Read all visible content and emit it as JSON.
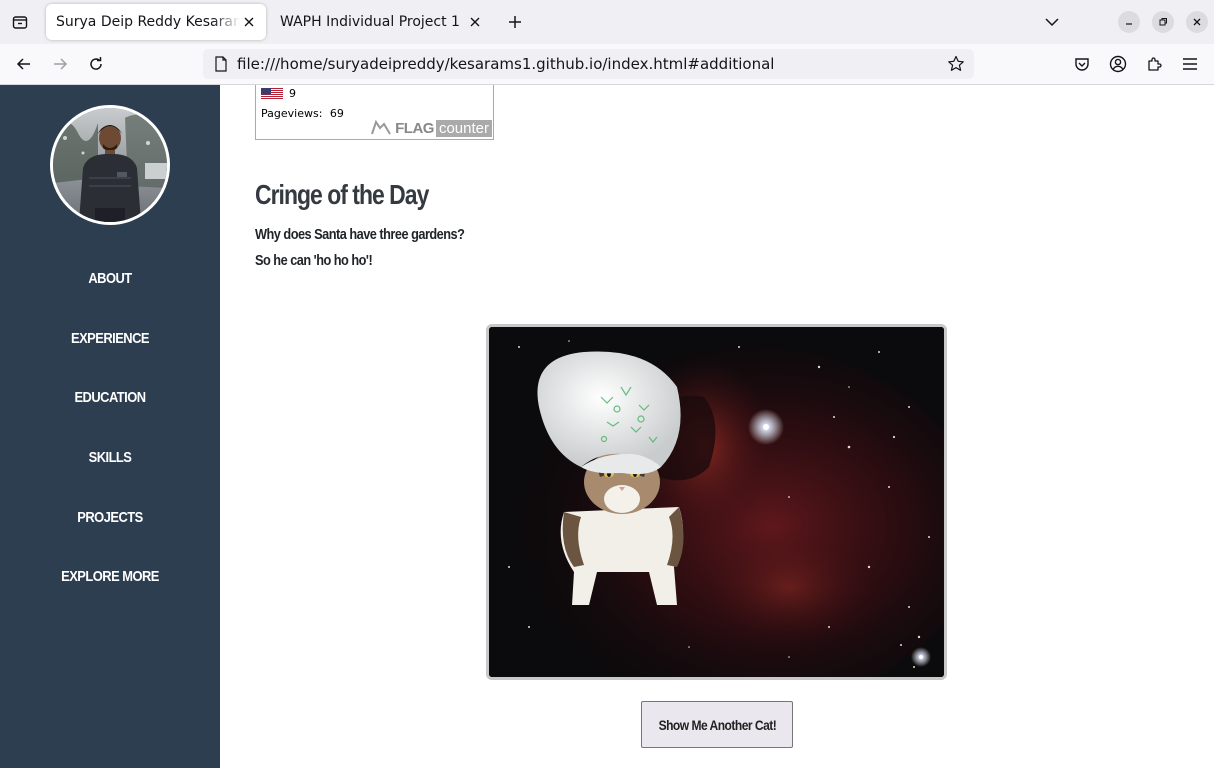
{
  "browser": {
    "tabs": [
      {
        "title": "Surya Deip Reddy Kesaram - I",
        "active": true
      },
      {
        "title": "WAPH Individual Project 1",
        "active": false
      }
    ],
    "url": "file:///home/suryadeipreddy/kesarams1.github.io/index.html#additional"
  },
  "sidebar": {
    "items": [
      {
        "label": "ABOUT"
      },
      {
        "label": "EXPERIENCE"
      },
      {
        "label": "EDUCATION"
      },
      {
        "label": "SKILLS"
      },
      {
        "label": "PROJECTS"
      },
      {
        "label": "EXPLORE MORE"
      }
    ]
  },
  "flag_counter": {
    "country_count": "9",
    "pageviews_label": "Pageviews:",
    "pageviews_value": "69",
    "logo_flag": "FLAG",
    "logo_counter": "counter"
  },
  "cringe": {
    "title": "Cringe of the Day",
    "question": "Why does Santa have three gardens?",
    "answer": "So he can 'ho ho ho'!"
  },
  "cat": {
    "button_label": "Show Me Another Cat!"
  },
  "colors": {
    "sidebar_bg": "#2c3e50",
    "nav_text": "#ffffff",
    "heading": "#343a40"
  }
}
